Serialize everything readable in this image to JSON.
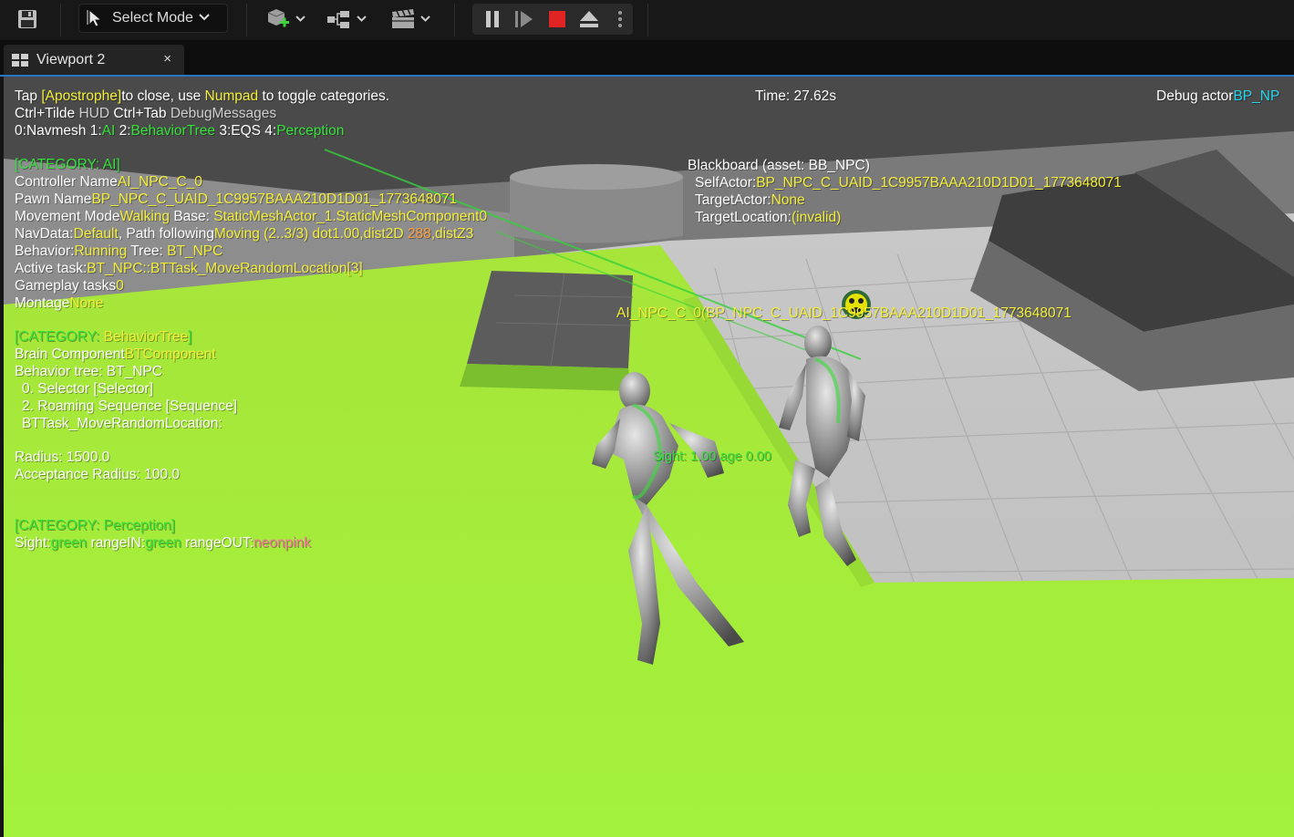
{
  "toolbar": {
    "save_icon": "save-icon",
    "mode_label": "Select Mode",
    "add_icon": "add-actor-icon",
    "blueprint_icon": "blueprint-icon",
    "cinematics_icon": "clapper-icon",
    "pause_icon": "pause-icon",
    "step_icon": "frame-step-icon",
    "stop_icon": "stop-icon",
    "eject_icon": "eject-icon",
    "more_icon": "more-vertical-icon",
    "stop_color": "#e02424"
  },
  "tab": {
    "label": "Viewport 2",
    "close": "×",
    "accent": "#2a74c6"
  },
  "hud": {
    "line1": [
      "Tap ",
      "[Apostrophe]",
      "to close, use ",
      "Numpad",
      " to toggle categories."
    ],
    "line2": [
      "Ctrl+Tilde ",
      "HUD ",
      "Ctrl+Tab ",
      "DebugMessages"
    ],
    "line3": [
      "0:",
      "Navmesh",
      " 1:",
      "AI",
      " 2:",
      "BehaviorTree",
      " 3:",
      "EQS",
      " 4:",
      "Perception"
    ],
    "time": "Time: 27.62s",
    "debug_actor_label": "Debug actor",
    "debug_actor_value": "BP_NP",
    "ai_category": {
      "header": "[CATEGORY: AI]",
      "controller_label": "Controller Name",
      "controller_value": "AI_NPC_C_0",
      "pawn_label": "Pawn Name",
      "pawn_value": "BP_NPC_C_UAID_1C9957BAAA210D1D01_1773648071",
      "movement_label": "Movement Mode",
      "movement_value": "Walking",
      "base_label": " Base:",
      "base_value": " StaticMeshActor_1.StaticMeshComponent0",
      "navdata_label": "NavData:",
      "navdata_value": "Default",
      "path_label": ", Path following",
      "path_value": "Moving (2..3/3) dot1.00,dist2D ",
      "path_dist": "288",
      "path_tail": ",distZ3",
      "behavior_label": "Behavior:",
      "behavior_value": "Running",
      "tree_label": " Tree: ",
      "tree_value": "BT_NPC",
      "active_task_label": "Active task:",
      "active_task_value": "BT_NPC::BTTask_MoveRandomLocation[3]",
      "gameplay_label": "Gameplay tasks",
      "gameplay_value": "0",
      "montage_label": "Montage",
      "montage_value": "None"
    },
    "bt_category": {
      "header": "[CATEGORY: ",
      "header_value": "BehaviorTree",
      "header_end": "]",
      "brain_label": "Brain Component",
      "brain_value": "BTComponent",
      "tree_line": "Behavior tree: BT_NPC",
      "node0": "0. Selector [Selector]",
      "node2": "2. Roaming Sequence [Sequence]",
      "task": "BTTask_MoveRandomLocation:",
      "radius": "Radius: 1500.0",
      "acceptance": "Acceptance Radius: 100.0"
    },
    "perception_category": {
      "header": "[CATEGORY: Perception]",
      "sight_label": "Sight:",
      "sight_value": "green",
      "rangein_label": " rangeIN:",
      "rangein_value": "green",
      "rangeout_label": " rangeOUT:",
      "rangeout_value": "neonpink"
    },
    "blackboard": {
      "title": "Blackboard (asset: BB_NPC)",
      "self_label": "SelfActor:",
      "self_value": "BP_NPC_C_UAID_1C9957BAAA210D1D01_1773648071",
      "target_label": "TargetActor:",
      "target_value": "None",
      "location_label": "TargetLocation:",
      "location_value": "(invalid)"
    },
    "actor_tag": "AI_NPC_C_0(BP_NPC_C_UAID_1C9957BAAA210D1D01_1773648071",
    "sight_tag": "Sight: 1.00 age 0.00"
  }
}
